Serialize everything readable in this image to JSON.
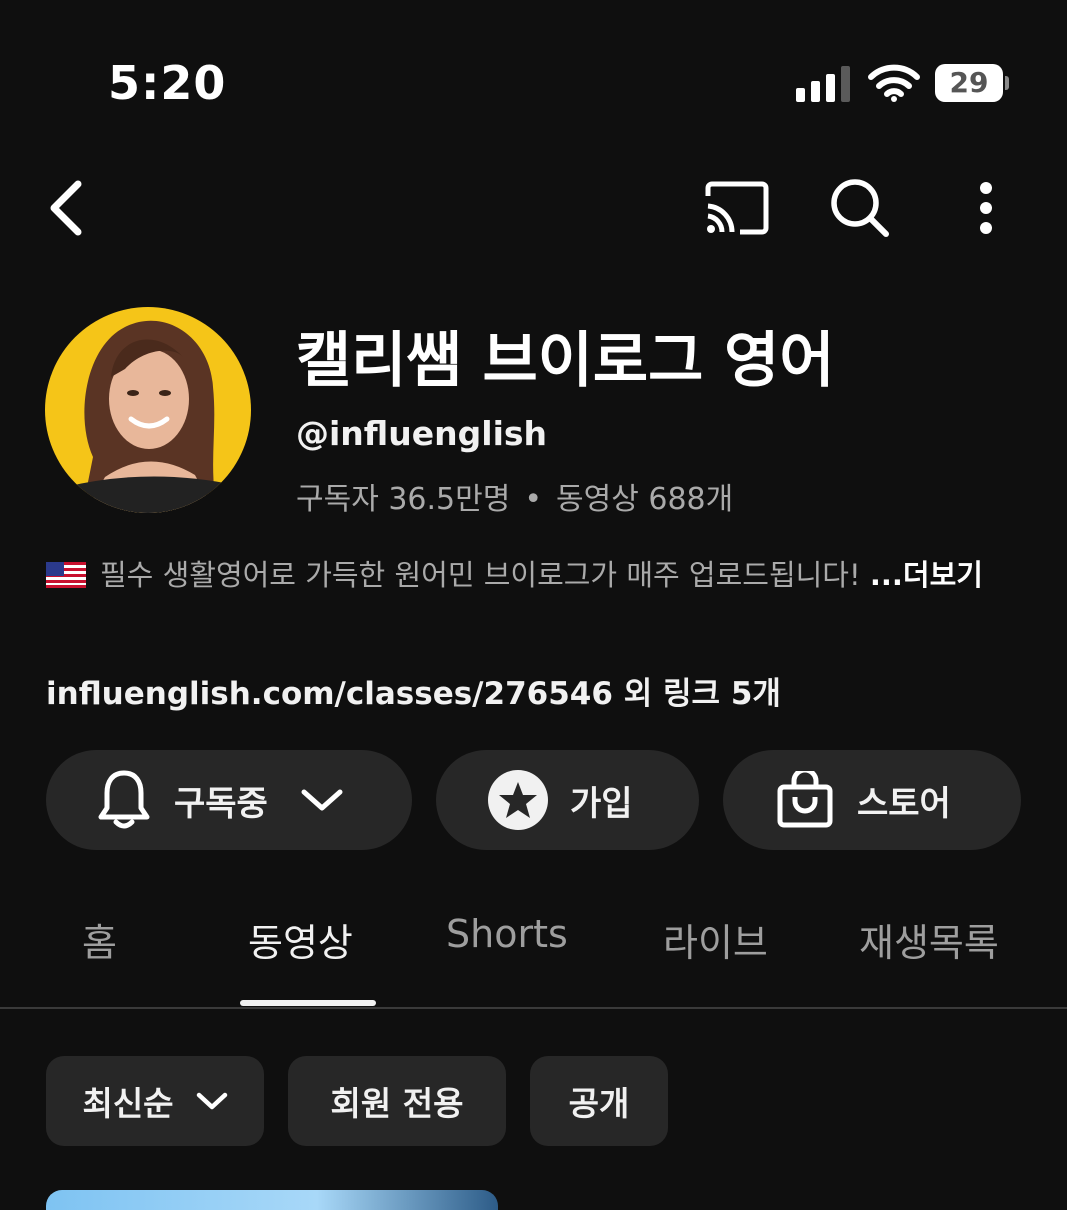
{
  "status_bar": {
    "time": "5:20",
    "battery": "29",
    "icons": [
      "signal-icon",
      "wifi-icon",
      "battery-icon"
    ]
  },
  "header": {
    "icons": [
      "back-icon",
      "cast-icon",
      "search-icon",
      "more-icon"
    ]
  },
  "channel": {
    "title": "캘리쌤 브이로그 영어",
    "handle": "@influenglish",
    "subscribers": "구독자 36.5만명",
    "separator": "•",
    "videos": "동영상 688개",
    "description": "필수 생활영어로 가득한 원어민 브이로그가 매주 업로드됩니다! ",
    "more": "...더보기",
    "links": "influenglish.com/classes/276546 외 링크 5개",
    "accent": "#f5c518"
  },
  "actions": {
    "subscribed": "구독중",
    "join": "가입",
    "store": "스토어"
  },
  "tabs": [
    {
      "label": "홈"
    },
    {
      "label": "동영상"
    },
    {
      "label": "Shorts"
    },
    {
      "label": "라이브"
    },
    {
      "label": "재생목록"
    }
  ],
  "active_tab": "동영상",
  "filters": [
    {
      "label": "최신순"
    },
    {
      "label": "회원 전용"
    },
    {
      "label": "공개"
    }
  ],
  "colors": {
    "background": "#0f0f0f",
    "surface": "#272727",
    "text": "#f1f1f1",
    "secondary_text": "#aaaaaa"
  }
}
